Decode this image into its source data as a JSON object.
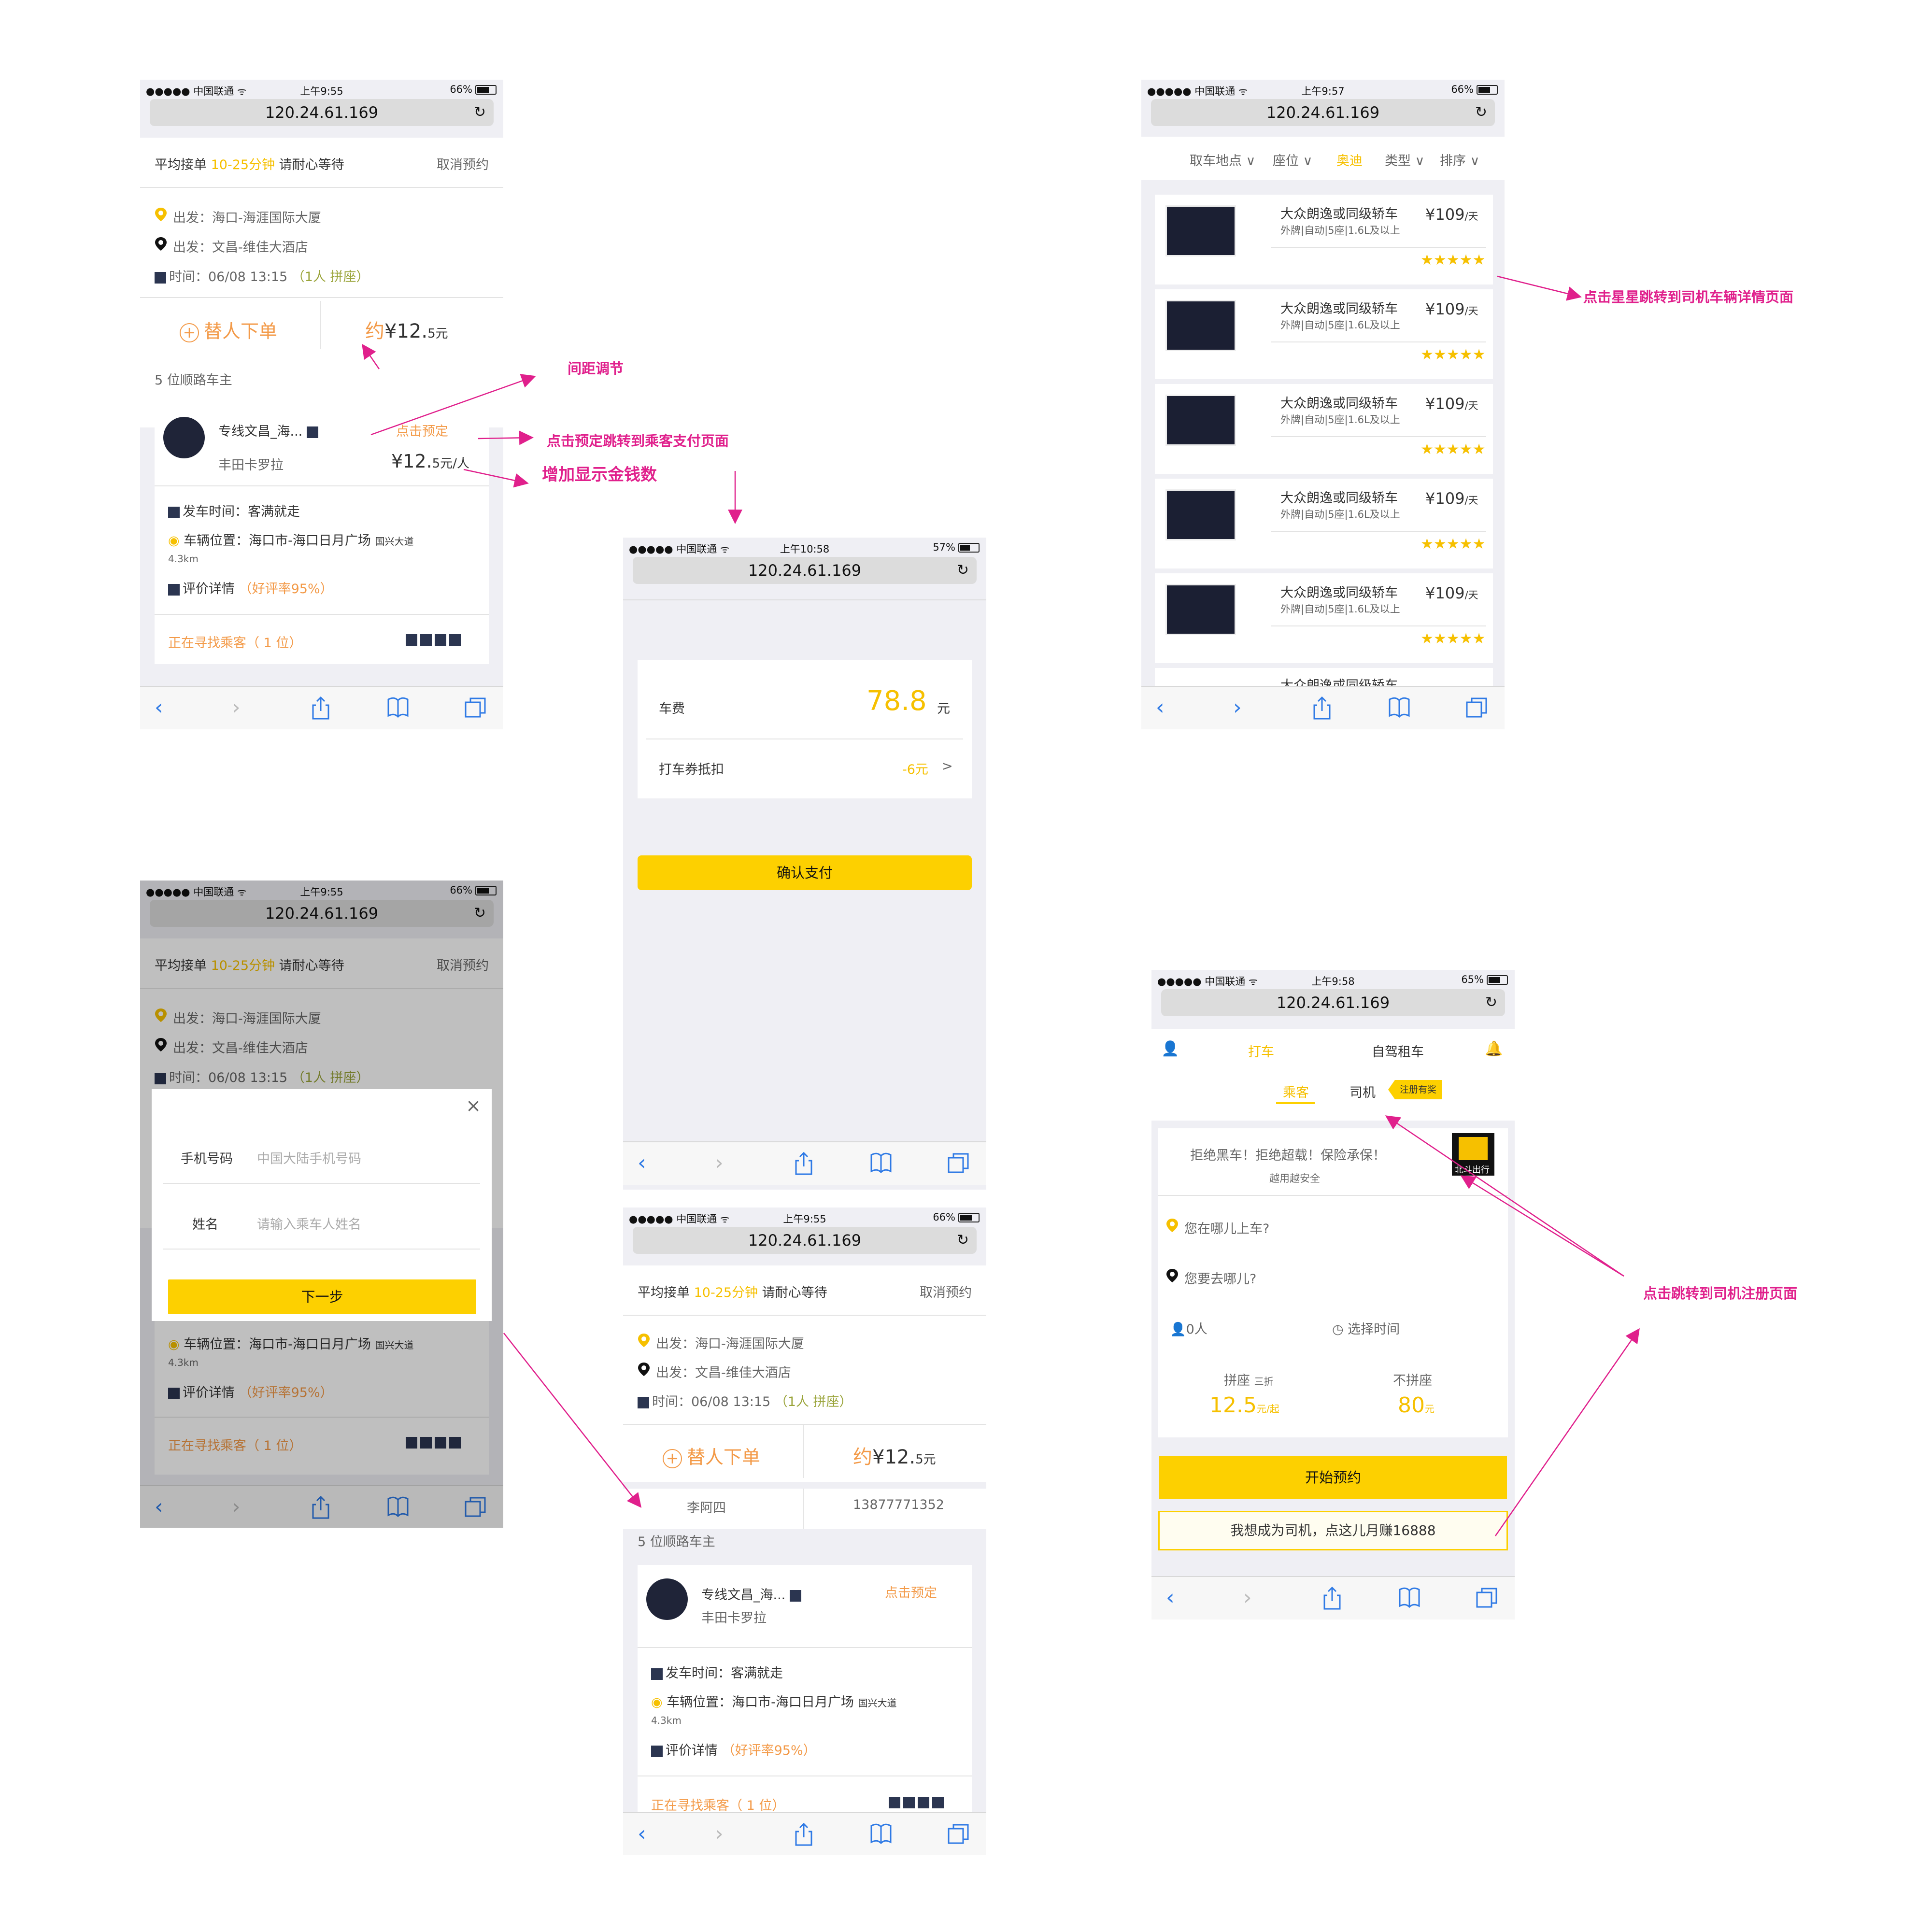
{
  "status_bar": {
    "carrier": "●●●●● 中国联通 ᯤ",
    "time_955": "上午9:55",
    "time_1058": "上午10:58",
    "time_957": "上午9:57",
    "time_958": "上午9:58",
    "battery_66": "66%",
    "battery_57": "57%",
    "battery_65": "65%"
  },
  "browser": {
    "url": "120.24.61.169",
    "reload": "↻"
  },
  "order": {
    "avg_prefix": "平均接单 ",
    "avg_range": "10-25分钟",
    "avg_suffix": " 请耐心等待",
    "cancel": "取消预约",
    "from_label": "出发：",
    "from_value": "海口-海涯国际大厦",
    "to_label": "出发：",
    "to_value": "文昌-维佳大酒店",
    "time_label": "时间：",
    "time_value": "06/08 13:15",
    "seat_note": "（1人 拼座）",
    "proxy_order": "替人下单",
    "price_prefix": "约",
    "price_main": "¥12.",
    "price_tail": "5元",
    "drivers_count": "5 位顺路车主"
  },
  "driver_card": {
    "name": "专线文昌_海...",
    "car": "丰田卡罗拉",
    "book": "点击预定",
    "price_main": "¥12.",
    "price_tail": "5元/人",
    "depart_label": "发车时间：",
    "depart_value": "客满就走",
    "loc_label": "车辆位置：",
    "loc_value": "海口市-海口日月广场",
    "loc_road": "国兴大道",
    "distance": "4.3km",
    "rating_label": "评价详情",
    "rating_value": "（好评率95%）",
    "searching": "正在寻找乘客（ 1 位）"
  },
  "payment": {
    "fare_label": "车费",
    "fare_value": "78.8",
    "fare_unit": "元",
    "coupon_label": "打车券抵扣",
    "coupon_value": "-6元",
    "coupon_arrow": ">",
    "confirm": "确认支付"
  },
  "modal": {
    "close": "×",
    "phone_label": "手机号码",
    "phone_placeholder": "中国大陆手机号码",
    "name_label": "姓名",
    "name_placeholder": "请输入乘车人姓名",
    "next": "下一步"
  },
  "proxy_row": {
    "name": "李阿四",
    "phone": "13877771352"
  },
  "rental": {
    "filters": [
      "取车地点 ∨",
      "座位 ∨",
      "奥迪",
      "类型 ∨",
      "排序 ∨"
    ],
    "items": [
      {
        "title": "大众朗逸或同级轿车",
        "spec": "外牌|自动|5座|1.6L及以上",
        "price": "¥109",
        "unit": "/天",
        "stars": "★★★★★"
      },
      {
        "title": "大众朗逸或同级轿车",
        "spec": "外牌|自动|5座|1.6L及以上",
        "price": "¥109",
        "unit": "/天",
        "stars": "★★★★★"
      },
      {
        "title": "大众朗逸或同级轿车",
        "spec": "外牌|自动|5座|1.6L及以上",
        "price": "¥109",
        "unit": "/天",
        "stars": "★★★★★"
      },
      {
        "title": "大众朗逸或同级轿车",
        "spec": "外牌|自动|5座|1.6L及以上",
        "price": "¥109",
        "unit": "/天",
        "stars": "★★★★★"
      },
      {
        "title": "大众朗逸或同级轿车",
        "spec": "外牌|自动|5座|1.6L及以上",
        "price": "¥109",
        "unit": "/天",
        "stars": "★★★★★"
      }
    ],
    "partial_title": "大众朗逸或同级轿车"
  },
  "home": {
    "tab_taxi": "打车",
    "tab_rent": "自驾租车",
    "sub_passenger": "乘客",
    "sub_driver": "司机",
    "reward_tag": "注册有奖",
    "slogan": "拒绝黑车！拒绝超载！保险承保！",
    "slogan_sub": "越用越安全",
    "logo_text": "北斗出行",
    "where_on": "您在哪儿上车?",
    "where_to": "您要去哪儿?",
    "persons": "0人",
    "choose_time": "选择时间",
    "carpool_label": "拼座",
    "carpool_discount": "三折",
    "carpool_price": "12.5",
    "carpool_unit": "元/起",
    "nocarpool_label": "不拼座",
    "nocarpool_price": "80",
    "nocarpool_unit": "元",
    "start_booking": "开始预约",
    "become_driver": "我想成为司机，点这儿月赚16888"
  },
  "annotations": {
    "spacing": "间距调节",
    "book_to_pay": "点击预定跳转到乘客支付页面",
    "show_amount": "增加显示金钱数",
    "stars_to_detail": "点击星星跳转到司机车辆详情页面",
    "to_driver_reg": "点击跳转到司机注册页面"
  },
  "colors": {
    "accent_yellow": "#fdd000",
    "orange": "#f39a48",
    "annotation": "#e0208c",
    "toolbar_blue": "#2f7ae5"
  }
}
